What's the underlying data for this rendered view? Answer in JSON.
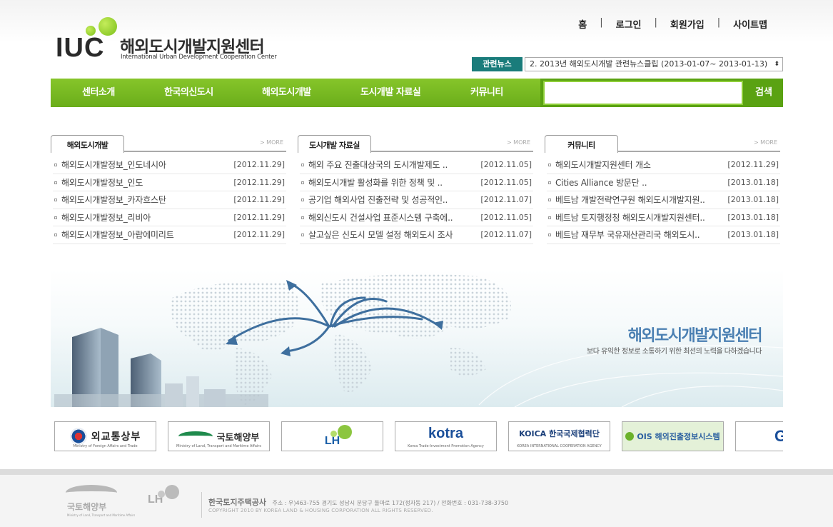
{
  "site": {
    "logo_abbr": "IUC",
    "logo_title": "해외도시개발지원센터",
    "logo_subtitle": "International Urban Development Cooperation Center"
  },
  "top_nav": [
    "홈",
    "로그인",
    "회원가입",
    "사이트맵"
  ],
  "related_news": {
    "label": "관련뉴스",
    "selected": "2. 2013년 해외도시개발 관련뉴스클립 (2013-01-07~ 2013-01-13)"
  },
  "gnb": {
    "items": [
      "센터소개",
      "한국의신도시",
      "해외도시개발",
      "도시개발 자료실",
      "커뮤니티"
    ],
    "search_button": "검색"
  },
  "boards": [
    {
      "title": "해외도시개발",
      "more": "> MORE",
      "items": [
        {
          "title": "해외도시개발정보_인도네시아",
          "date": "[2012.11.29]"
        },
        {
          "title": "해외도시개발정보_인도",
          "date": "[2012.11.29]"
        },
        {
          "title": "해외도시개발정보_카자흐스탄",
          "date": "[2012.11.29]"
        },
        {
          "title": "해외도시개발정보_리비아",
          "date": "[2012.11.29]"
        },
        {
          "title": "해외도시개발정보_아랍에미리트",
          "date": "[2012.11.29]"
        }
      ]
    },
    {
      "title": "도시개발 자료실",
      "more": "> MORE",
      "items": [
        {
          "title": "해외 주요 진출대상국의 도시개발제도 ..",
          "date": "[2012.11.05]"
        },
        {
          "title": "해외도시개발 활성화를 위한 정책 및 ..",
          "date": "[2012.11.05]"
        },
        {
          "title": "공기업 해외사업 진출전략 및 성공적인..",
          "date": "[2012.11.07]"
        },
        {
          "title": "해외신도시 건설사업 표준시스템 구축에..",
          "date": "[2012.11.05]"
        },
        {
          "title": "살고싶은 신도시 모델 설정 해외도시 조사",
          "date": "[2012.11.07]"
        }
      ]
    },
    {
      "title": "커뮤니티",
      "more": "> MORE",
      "items": [
        {
          "title": "해외도시개발지원센터 개소",
          "date": "[2012.11.29]"
        },
        {
          "title": "Cities Alliance 방문단 ..",
          "date": "[2013.01.18]"
        },
        {
          "title": "베트남 개발전략연구원 해외도시개발지원..",
          "date": "[2013.01.18]"
        },
        {
          "title": "베트남 토지행정청 해외도시개발지원센터..",
          "date": "[2013.01.18]"
        },
        {
          "title": "베트남 재무부 국유재산관리국 해외도시..",
          "date": "[2013.01.18]"
        }
      ]
    }
  ],
  "banner": {
    "title": "해외도시개발지원센터",
    "subtitle": "보다 유익한 정보로 소통하기 위한 최선의 노력을 다하겠습니다"
  },
  "partners": [
    {
      "name": "외교통상부",
      "sub": "Ministry of Foreign Affairs and Trade",
      "color": "#222222"
    },
    {
      "name": "국토해양부",
      "sub": "Ministry of Land, Transport and Maritime Affairs",
      "color": "#333333"
    },
    {
      "name": "LH",
      "sub": "",
      "color": "#1a5fa8"
    },
    {
      "name": "kotra",
      "sub": "Korea Trade-Investment Promotion Agency",
      "color": "#1a4f9a"
    },
    {
      "name": "KOICA 한국국제협력단",
      "sub": "KOREA INTERNATIONAL COOPERATION AGENCY",
      "color": "#1a3f7a"
    },
    {
      "name": "OIS 해외진출정보시스템",
      "sub": "",
      "color": "#2a5fa0"
    },
    {
      "name": "GD",
      "sub": "",
      "color": "#1a4f9a"
    }
  ],
  "footer": {
    "logo1": "국토해양부",
    "logo1_en": "Ministry of Land, Transport and Maritime Affairs",
    "logo2": "LH",
    "org": "한국토지주택공사",
    "address": "주소 : 우)463-755 경기도 성남시 분당구 돌마로 172(정자동 217) / 전화번호 : 031-738-3750",
    "copyright": "COPYRIGHT 2010 BY KOREA LAND & HOUSING CORPORATION ALL RIGHTS RESERVED."
  },
  "colors": {
    "gnb_green": "#76b820",
    "news_label": "#1a7c7b",
    "banner_title": "#4a7fb2"
  }
}
